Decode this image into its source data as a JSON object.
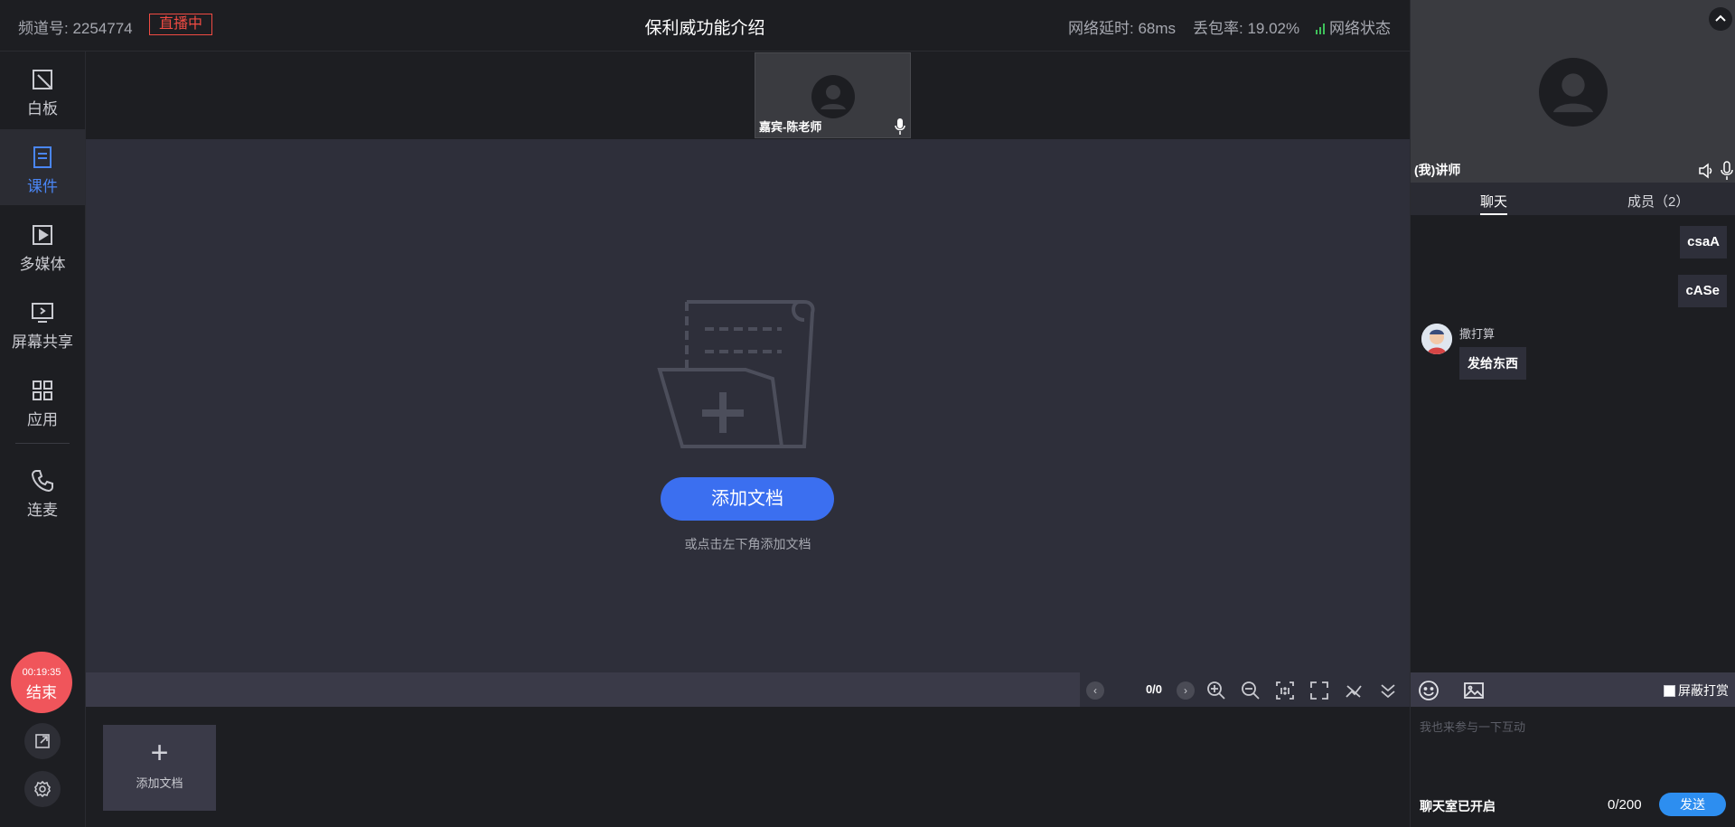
{
  "header": {
    "channel": "频道号: 2254774",
    "live_badge": "直播中",
    "title": "保利威功能介绍",
    "latency": "网络延时: 68ms",
    "packet_loss": "丢包率: 19.02%",
    "network": "网络状态",
    "network_color": "#3fc15a"
  },
  "sidebar": {
    "items": [
      {
        "label": "白板",
        "icon": "whiteboard-icon"
      },
      {
        "label": "课件",
        "icon": "courseware-icon"
      },
      {
        "label": "多媒体",
        "icon": "media-icon"
      },
      {
        "label": "屏幕共享",
        "icon": "screen-share-icon"
      },
      {
        "label": "应用",
        "icon": "apps-icon"
      },
      {
        "label": "连麦",
        "icon": "phone-icon"
      }
    ],
    "active": "课件",
    "timer": "00:19:35",
    "end_label": "结束"
  },
  "guest_video": {
    "name": "嘉宾-陈老师"
  },
  "stage": {
    "add_button": "添加文档",
    "hint": "或点击左下角添加文档"
  },
  "toolbar": {
    "page_indicator": "0/0",
    "prev": "‹",
    "next": "›"
  },
  "thumbs": {
    "add_label": "添加文档",
    "plus": "+"
  },
  "right_panel": {
    "teacher_name": "(我)讲师",
    "tabs": [
      "聊天",
      "成员（2）"
    ],
    "messages_mine": [
      "csaA",
      "cASe"
    ],
    "other_message": {
      "name": "撒打算",
      "text": "发给东西"
    },
    "shield_label": "屏蔽打赏",
    "input_placeholder": "我也来参与一下互动",
    "chat_status": "聊天室已开启",
    "char_count": "0/200",
    "send_label": "发送"
  },
  "colors": {
    "accent": "#3b6ff0",
    "live_red": "#f04b43",
    "end_red": "#f0555b",
    "send_blue": "#2d8ef0"
  }
}
